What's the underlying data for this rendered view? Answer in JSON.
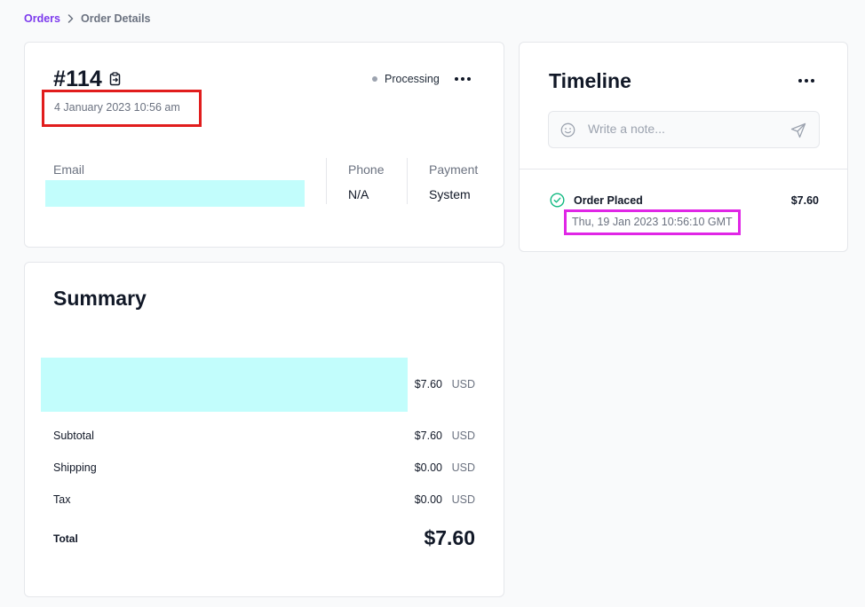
{
  "breadcrumb": {
    "parent": "Orders",
    "current": "Order Details"
  },
  "order": {
    "number": "#114",
    "date": "4 January 2023 10:56 am",
    "status": "Processing",
    "status_color": "#9ca3af",
    "email_label": "Email",
    "phone_label": "Phone",
    "phone_value": "N/A",
    "payment_label": "Payment",
    "payment_value": "System"
  },
  "summary": {
    "title": "Summary",
    "item": {
      "amount": "$7.60",
      "currency": "USD"
    },
    "rows": [
      {
        "label": "Subtotal",
        "amount": "$7.60",
        "currency": "USD"
      },
      {
        "label": "Shipping",
        "amount": "$0.00",
        "currency": "USD"
      },
      {
        "label": "Tax",
        "amount": "$0.00",
        "currency": "USD"
      }
    ],
    "total_label": "Total",
    "total_amount": "$7.60"
  },
  "timeline": {
    "title": "Timeline",
    "note_placeholder": "Write a note...",
    "events": [
      {
        "title": "Order Placed",
        "amount": "$7.60",
        "date": "Thu, 19 Jan 2023 10:56:10 GMT"
      }
    ]
  },
  "colors": {
    "accent": "#7c3aed",
    "success": "#10b981",
    "redaction": "#c2fdfc"
  }
}
